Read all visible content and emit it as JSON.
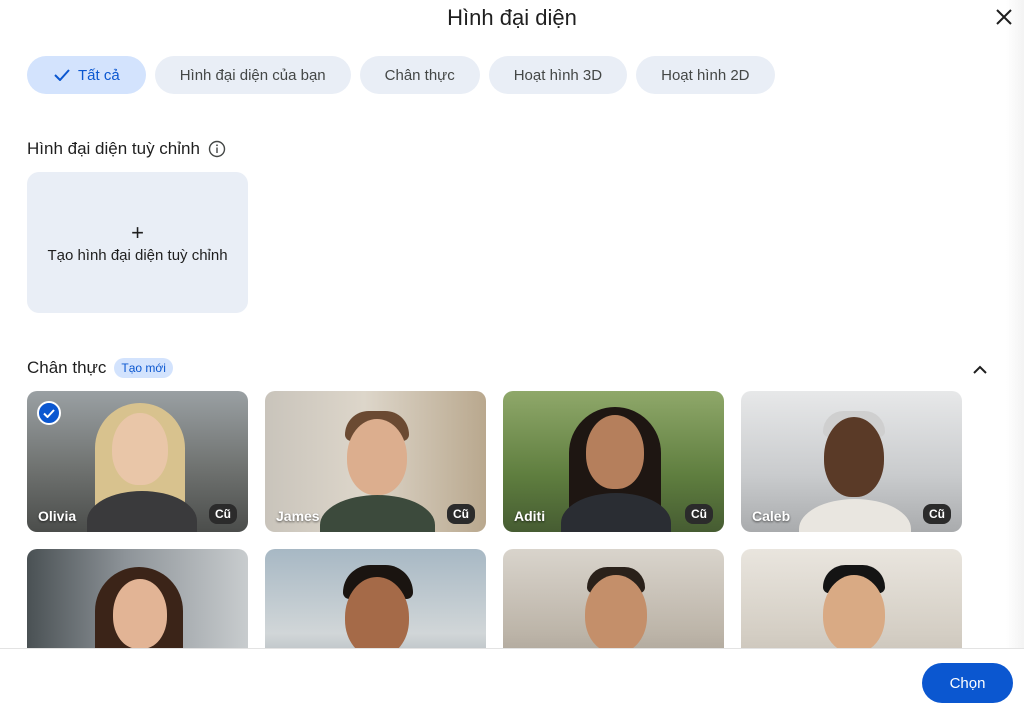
{
  "dialog": {
    "title": "Hình đại diện",
    "close_icon": "close-icon"
  },
  "filters": [
    {
      "label": "Tất cả",
      "selected": true
    },
    {
      "label": "Hình đại diện của bạn",
      "selected": false
    },
    {
      "label": "Chân thực",
      "selected": false
    },
    {
      "label": "Hoạt hình 3D",
      "selected": false
    },
    {
      "label": "Hoạt hình 2D",
      "selected": false
    }
  ],
  "custom_section": {
    "title": "Hình đại diện tuỳ chỉnh",
    "info_icon": "info-icon",
    "create_label": "Tạo hình đại diện tuỳ chỉnh",
    "plus": "+"
  },
  "realistic_section": {
    "title": "Chân thực",
    "badge": "Tạo mới",
    "avatars": [
      {
        "name": "Olivia",
        "tag": "Cũ",
        "selected": true
      },
      {
        "name": "James",
        "tag": "Cũ",
        "selected": false
      },
      {
        "name": "Aditi",
        "tag": "Cũ",
        "selected": false
      },
      {
        "name": "Caleb",
        "tag": "Cũ",
        "selected": false
      },
      {
        "name": "",
        "tag": "",
        "selected": false
      },
      {
        "name": "",
        "tag": "",
        "selected": false
      },
      {
        "name": "",
        "tag": "",
        "selected": false
      },
      {
        "name": "",
        "tag": "",
        "selected": false
      }
    ]
  },
  "footer": {
    "choose_label": "Chọn"
  },
  "colors": {
    "accent": "#0b57d0",
    "chip_bg": "#e9eef6",
    "chip_selected_bg": "#d3e3fd"
  }
}
